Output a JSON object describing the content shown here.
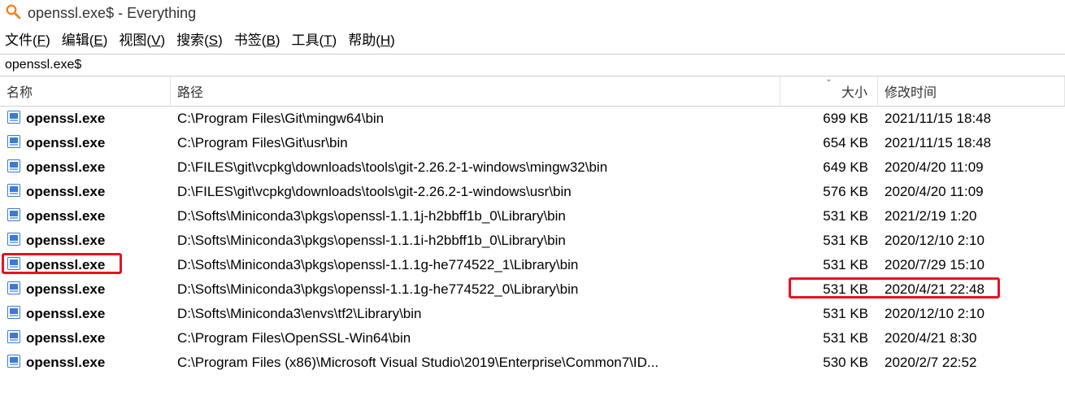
{
  "window": {
    "title": "openssl.exe$ - Everything"
  },
  "menu": {
    "file": {
      "label": "文件",
      "accel": "F"
    },
    "edit": {
      "label": "编辑",
      "accel": "E"
    },
    "view": {
      "label": "视图",
      "accel": "V"
    },
    "search": {
      "label": "搜索",
      "accel": "S"
    },
    "bookmark": {
      "label": "书签",
      "accel": "B"
    },
    "tools": {
      "label": "工具",
      "accel": "T"
    },
    "help": {
      "label": "帮助",
      "accel": "H"
    }
  },
  "search_box": {
    "value": "openssl.exe$"
  },
  "columns": {
    "name": "名称",
    "path": "路径",
    "size": "大小",
    "mtime": "修改时间",
    "sorted_by": "size",
    "sort_dir": "desc"
  },
  "rows": [
    {
      "name": "openssl.exe",
      "path": "C:\\Program Files\\Git\\mingw64\\bin",
      "size": "699 KB",
      "mtime": "2021/11/15 18:48"
    },
    {
      "name": "openssl.exe",
      "path": "C:\\Program Files\\Git\\usr\\bin",
      "size": "654 KB",
      "mtime": "2021/11/15 18:48"
    },
    {
      "name": "openssl.exe",
      "path": "D:\\FILES\\git\\vcpkg\\downloads\\tools\\git-2.26.2-1-windows\\mingw32\\bin",
      "size": "649 KB",
      "mtime": "2020/4/20 11:09"
    },
    {
      "name": "openssl.exe",
      "path": "D:\\FILES\\git\\vcpkg\\downloads\\tools\\git-2.26.2-1-windows\\usr\\bin",
      "size": "576 KB",
      "mtime": "2020/4/20 11:09"
    },
    {
      "name": "openssl.exe",
      "path": "D:\\Softs\\Miniconda3\\pkgs\\openssl-1.1.1j-h2bbff1b_0\\Library\\bin",
      "size": "531 KB",
      "mtime": "2021/2/19 1:20"
    },
    {
      "name": "openssl.exe",
      "path": "D:\\Softs\\Miniconda3\\pkgs\\openssl-1.1.1i-h2bbff1b_0\\Library\\bin",
      "size": "531 KB",
      "mtime": "2020/12/10 2:10"
    },
    {
      "name": "openssl.exe",
      "path": "D:\\Softs\\Miniconda3\\pkgs\\openssl-1.1.1g-he774522_1\\Library\\bin",
      "size": "531 KB",
      "mtime": "2020/7/29 15:10"
    },
    {
      "name": "openssl.exe",
      "path": "D:\\Softs\\Miniconda3\\pkgs\\openssl-1.1.1g-he774522_0\\Library\\bin",
      "size": "531 KB",
      "mtime": "2020/4/21 22:48"
    },
    {
      "name": "openssl.exe",
      "path": "D:\\Softs\\Miniconda3\\envs\\tf2\\Library\\bin",
      "size": "531 KB",
      "mtime": "2020/12/10 2:10"
    },
    {
      "name": "openssl.exe",
      "path": "C:\\Program Files\\OpenSSL-Win64\\bin",
      "size": "531 KB",
      "mtime": "2020/4/21 8:30"
    },
    {
      "name": "openssl.exe",
      "path": "C:\\Program Files (x86)\\Microsoft Visual Studio\\2019\\Enterprise\\Common7\\ID...",
      "size": "530 KB",
      "mtime": "2020/2/7 22:52"
    }
  ],
  "highlights": {
    "name_row_index": 6,
    "size_mtime_row_index": 7
  }
}
